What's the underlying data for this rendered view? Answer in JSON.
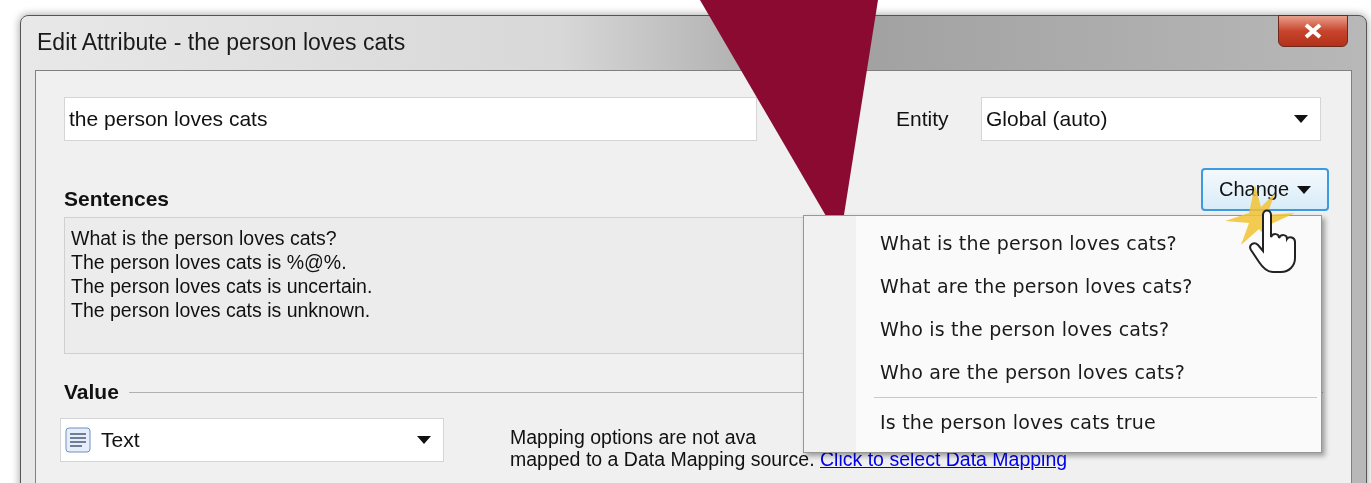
{
  "window": {
    "title": "Edit Attribute - the person loves cats"
  },
  "name_field": {
    "value": "the person loves cats"
  },
  "entity": {
    "label": "Entity",
    "value": "Global (auto)"
  },
  "sentences": {
    "heading": "Sentences",
    "change_button": "Change",
    "lines": [
      "What is the person loves cats?",
      "The person loves cats is %@%.",
      "The person loves cats is uncertain.",
      "The person loves cats is unknown."
    ]
  },
  "change_menu": {
    "groups": [
      [
        "What is the person loves cats?",
        "What are the person loves cats?",
        "Who is the person loves cats?",
        "Who are the person loves cats?"
      ],
      [
        "Is the person loves cats true"
      ]
    ]
  },
  "value": {
    "heading": "Value",
    "type_select": "Text",
    "mapping_note": "Mapping options are not ava",
    "mapping_note_2": "mapped to a Data Mapping source.",
    "mapping_link": "Click to select Data Mapping"
  }
}
